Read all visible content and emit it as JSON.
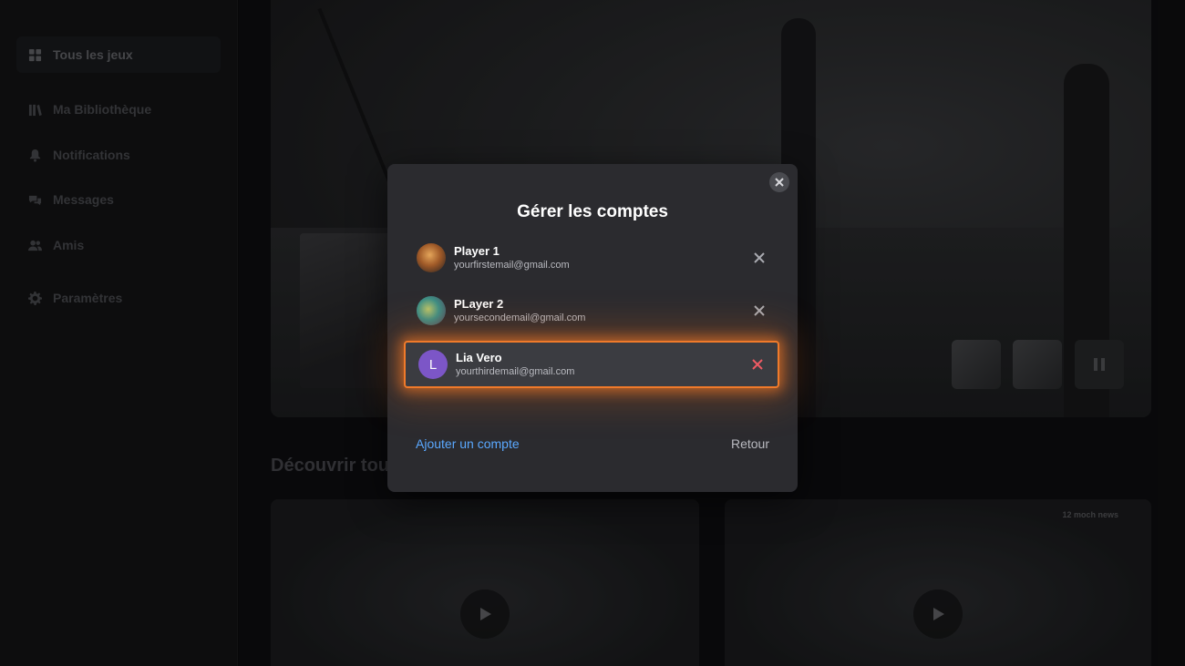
{
  "sidebar": {
    "items": [
      {
        "label": "Tous les jeux",
        "icon": "grid-icon",
        "active": true
      },
      {
        "label": "Ma Bibliothèque",
        "icon": "library-icon",
        "active": false
      },
      {
        "label": "Notifications",
        "icon": "bell-icon",
        "active": false
      },
      {
        "label": "Messages",
        "icon": "chat-bubbles-icon",
        "active": false
      },
      {
        "label": "Amis",
        "icon": "friends-icon",
        "active": false
      },
      {
        "label": "Paramètres",
        "icon": "gear-icon",
        "active": false
      }
    ]
  },
  "main": {
    "section_title": "Découvrir tous",
    "news_badge": "12 moch news"
  },
  "modal": {
    "title": "Gérer les comptes",
    "accounts": [
      {
        "name": "Player 1",
        "email": "yourfirstemail@gmail.com",
        "avatar_initial": ""
      },
      {
        "name": "PLayer 2",
        "email": "yoursecondemail@gmail.com",
        "avatar_initial": ""
      },
      {
        "name": "Lia Vero",
        "email": "yourthirdemail@gmail.com",
        "avatar_initial": "L"
      }
    ],
    "add_account_label": "Ajouter un compte",
    "back_label": "Retour"
  },
  "colors": {
    "accent_link": "#5aa8ff",
    "selection_glow": "#f07a2a",
    "remove_active": "#ee5a63",
    "avatar_lia": "#7c56c7"
  }
}
